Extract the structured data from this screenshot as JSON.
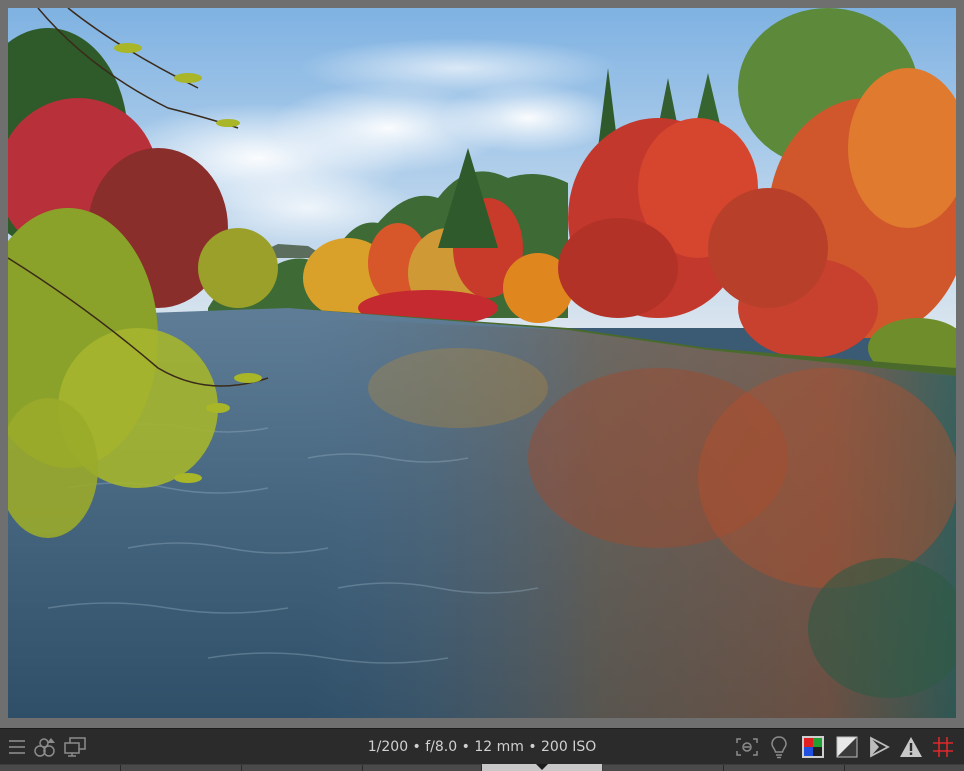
{
  "image_info": {
    "exif_summary": "1/200 • f/8.0 • 12 mm • 200 ISO"
  },
  "toolbar": {
    "left_icons": [
      "hamburger-menu-icon",
      "color-labels-icon",
      "second-display-icon"
    ],
    "right_icons": [
      "focus-peaking-icon",
      "lightbulb-icon",
      "color-assessment-icon",
      "softproof-icon",
      "gamut-check-icon",
      "overexposure-warning-icon",
      "guides-grid-icon"
    ]
  },
  "colors": {
    "toolbar_bg": "#2b2b2b",
    "frame_bg": "#6f6f6f",
    "exif_text": "#d0d0d0",
    "icon_gray": "#9a9a9a",
    "guides_red": "#e0282a"
  }
}
